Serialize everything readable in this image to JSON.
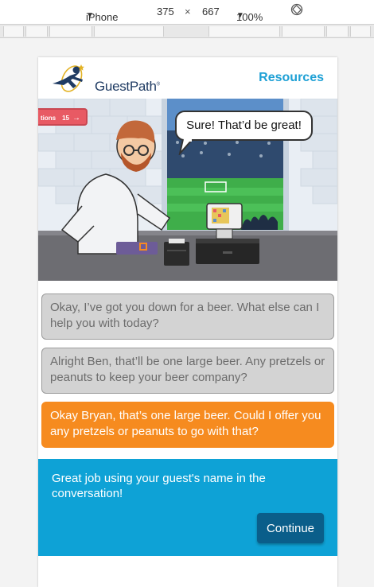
{
  "devtools": {
    "device": "iPhone 6",
    "width": "375",
    "times": "×",
    "height": "667",
    "zoom": "100%"
  },
  "header": {
    "logo_text": "GuestPath",
    "resources_label": "Resources"
  },
  "scene": {
    "progress_label": "tions",
    "progress_count": "15",
    "speech": "Sure! That’d be great!"
  },
  "options": [
    {
      "text": "Okay, I’ve got you down for a beer. What else can I help you with today?",
      "state": "incorrect"
    },
    {
      "text": "Alright Ben, that’ll be one large beer. Any pretzels or peanuts to keep your beer company?",
      "state": "incorrect"
    },
    {
      "text": "Okay Bryan, that’s one large beer. Could I offer you any pretzels or peanuts to go with that?",
      "state": "selected"
    }
  ],
  "feedback": {
    "message": "Great job using your guest's name in the conversation!",
    "continue_label": "Continue"
  },
  "colors": {
    "accent_blue": "#0ea2d6",
    "selected_orange": "#f68b1f",
    "button_dark_blue": "#0a5e8a",
    "logo_navy": "#1f3b63"
  }
}
